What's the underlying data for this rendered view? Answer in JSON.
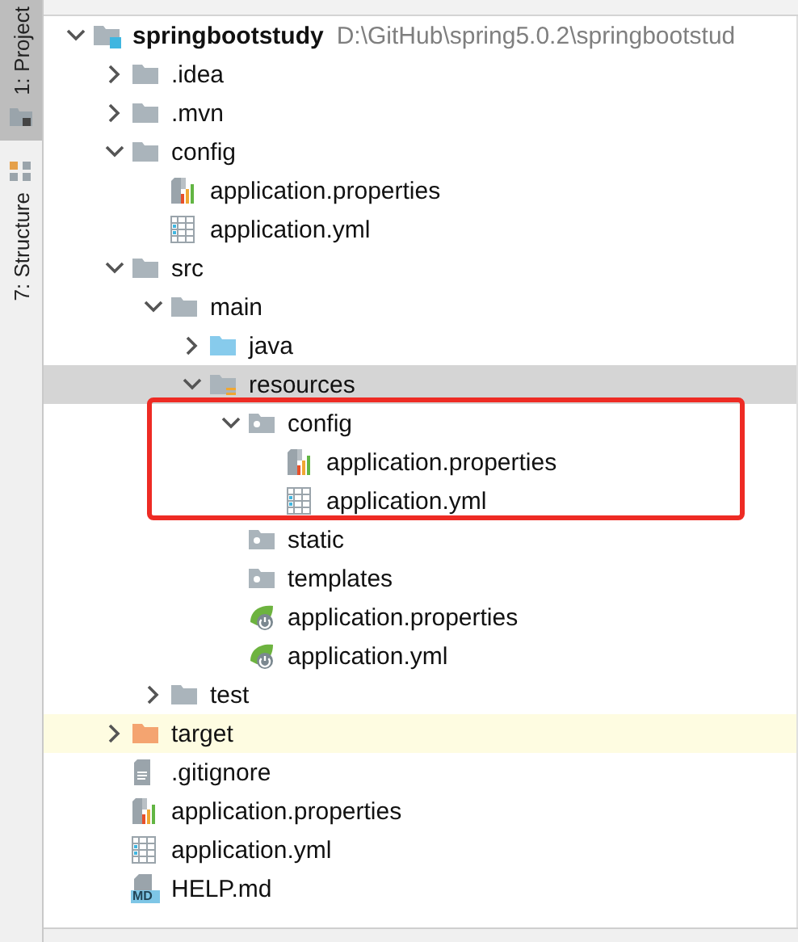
{
  "tool_strip": {
    "tabs": [
      {
        "label": "1: Project",
        "selected": true
      },
      {
        "label": "7: Structure",
        "selected": false
      }
    ]
  },
  "tree": [
    {
      "label": "springbootstudy",
      "path": "D:\\GitHub\\spring5.0.2\\springbootstud",
      "kind": "module",
      "expanded": true,
      "selected": false,
      "highlighted": false,
      "children": [
        {
          "label": ".idea",
          "kind": "folder",
          "expanded": false,
          "selected": false,
          "highlighted": false
        },
        {
          "label": ".mvn",
          "kind": "folder",
          "expanded": false,
          "selected": false,
          "highlighted": false
        },
        {
          "label": "config",
          "kind": "folder",
          "expanded": true,
          "selected": false,
          "highlighted": false,
          "children": [
            {
              "label": "application.properties",
              "kind": "properties",
              "selected": false,
              "highlighted": false
            },
            {
              "label": "application.yml",
              "kind": "yml",
              "selected": false,
              "highlighted": false
            }
          ]
        },
        {
          "label": "src",
          "kind": "folder",
          "expanded": true,
          "selected": false,
          "highlighted": false,
          "children": [
            {
              "label": "main",
              "kind": "folder",
              "expanded": true,
              "selected": false,
              "highlighted": false,
              "children": [
                {
                  "label": "java",
                  "kind": "source_folder",
                  "expanded": false,
                  "selected": false,
                  "highlighted": false
                },
                {
                  "label": "resources",
                  "kind": "resources_folder",
                  "expanded": true,
                  "selected": true,
                  "highlighted": false,
                  "children": [
                    {
                      "label": "config",
                      "kind": "package_folder",
                      "expanded": true,
                      "selected": false,
                      "highlighted": false,
                      "framed": true,
                      "children": [
                        {
                          "label": "application.properties",
                          "kind": "properties",
                          "selected": false,
                          "highlighted": false
                        },
                        {
                          "label": "application.yml",
                          "kind": "yml",
                          "selected": false,
                          "highlighted": false
                        }
                      ]
                    },
                    {
                      "label": "static",
                      "kind": "package_folder",
                      "selected": false,
                      "highlighted": false
                    },
                    {
                      "label": "templates",
                      "kind": "package_folder",
                      "selected": false,
                      "highlighted": false
                    },
                    {
                      "label": "application.properties",
                      "kind": "spring_config",
                      "selected": false,
                      "highlighted": false
                    },
                    {
                      "label": "application.yml",
                      "kind": "spring_config",
                      "selected": false,
                      "highlighted": false
                    }
                  ]
                }
              ]
            },
            {
              "label": "test",
              "kind": "folder",
              "expanded": false,
              "selected": false,
              "highlighted": false
            }
          ]
        },
        {
          "label": "target",
          "kind": "excluded_folder",
          "expanded": false,
          "selected": false,
          "highlighted": true
        },
        {
          "label": ".gitignore",
          "kind": "text",
          "selected": false,
          "highlighted": false
        },
        {
          "label": "application.properties",
          "kind": "properties",
          "selected": false,
          "highlighted": false
        },
        {
          "label": "application.yml",
          "kind": "yml",
          "selected": false,
          "highlighted": false
        },
        {
          "label": "HELP.md",
          "kind": "markdown",
          "icon_text": "MD",
          "selected": false,
          "highlighted": false
        }
      ]
    }
  ]
}
